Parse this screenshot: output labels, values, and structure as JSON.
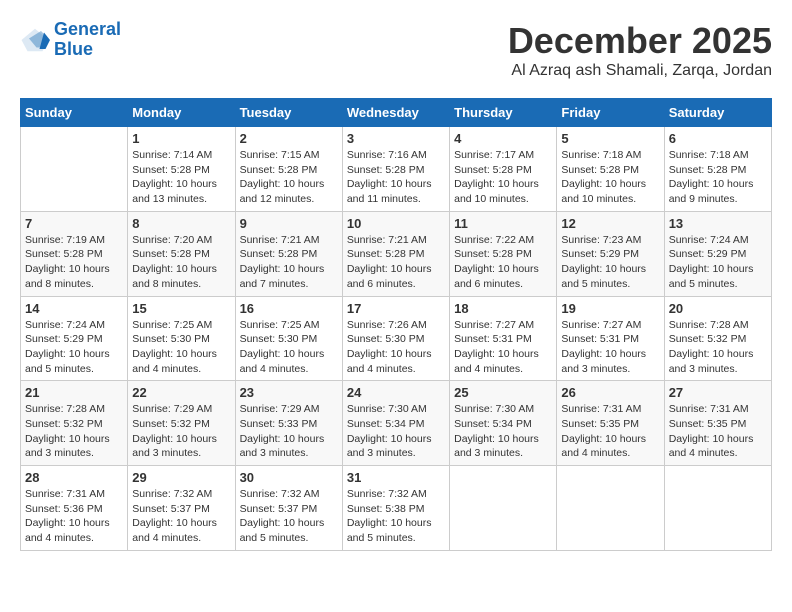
{
  "logo": {
    "line1": "General",
    "line2": "Blue"
  },
  "header": {
    "month_title": "December 2025",
    "location": "Al Azraq ash Shamali, Zarqa, Jordan"
  },
  "weekdays": [
    "Sunday",
    "Monday",
    "Tuesday",
    "Wednesday",
    "Thursday",
    "Friday",
    "Saturday"
  ],
  "weeks": [
    [
      {
        "day": "",
        "info": ""
      },
      {
        "day": "1",
        "info": "Sunrise: 7:14 AM\nSunset: 5:28 PM\nDaylight: 10 hours\nand 13 minutes."
      },
      {
        "day": "2",
        "info": "Sunrise: 7:15 AM\nSunset: 5:28 PM\nDaylight: 10 hours\nand 12 minutes."
      },
      {
        "day": "3",
        "info": "Sunrise: 7:16 AM\nSunset: 5:28 PM\nDaylight: 10 hours\nand 11 minutes."
      },
      {
        "day": "4",
        "info": "Sunrise: 7:17 AM\nSunset: 5:28 PM\nDaylight: 10 hours\nand 10 minutes."
      },
      {
        "day": "5",
        "info": "Sunrise: 7:18 AM\nSunset: 5:28 PM\nDaylight: 10 hours\nand 10 minutes."
      },
      {
        "day": "6",
        "info": "Sunrise: 7:18 AM\nSunset: 5:28 PM\nDaylight: 10 hours\nand 9 minutes."
      }
    ],
    [
      {
        "day": "7",
        "info": "Sunrise: 7:19 AM\nSunset: 5:28 PM\nDaylight: 10 hours\nand 8 minutes."
      },
      {
        "day": "8",
        "info": "Sunrise: 7:20 AM\nSunset: 5:28 PM\nDaylight: 10 hours\nand 8 minutes."
      },
      {
        "day": "9",
        "info": "Sunrise: 7:21 AM\nSunset: 5:28 PM\nDaylight: 10 hours\nand 7 minutes."
      },
      {
        "day": "10",
        "info": "Sunrise: 7:21 AM\nSunset: 5:28 PM\nDaylight: 10 hours\nand 6 minutes."
      },
      {
        "day": "11",
        "info": "Sunrise: 7:22 AM\nSunset: 5:28 PM\nDaylight: 10 hours\nand 6 minutes."
      },
      {
        "day": "12",
        "info": "Sunrise: 7:23 AM\nSunset: 5:29 PM\nDaylight: 10 hours\nand 5 minutes."
      },
      {
        "day": "13",
        "info": "Sunrise: 7:24 AM\nSunset: 5:29 PM\nDaylight: 10 hours\nand 5 minutes."
      }
    ],
    [
      {
        "day": "14",
        "info": "Sunrise: 7:24 AM\nSunset: 5:29 PM\nDaylight: 10 hours\nand 5 minutes."
      },
      {
        "day": "15",
        "info": "Sunrise: 7:25 AM\nSunset: 5:30 PM\nDaylight: 10 hours\nand 4 minutes."
      },
      {
        "day": "16",
        "info": "Sunrise: 7:25 AM\nSunset: 5:30 PM\nDaylight: 10 hours\nand 4 minutes."
      },
      {
        "day": "17",
        "info": "Sunrise: 7:26 AM\nSunset: 5:30 PM\nDaylight: 10 hours\nand 4 minutes."
      },
      {
        "day": "18",
        "info": "Sunrise: 7:27 AM\nSunset: 5:31 PM\nDaylight: 10 hours\nand 4 minutes."
      },
      {
        "day": "19",
        "info": "Sunrise: 7:27 AM\nSunset: 5:31 PM\nDaylight: 10 hours\nand 3 minutes."
      },
      {
        "day": "20",
        "info": "Sunrise: 7:28 AM\nSunset: 5:32 PM\nDaylight: 10 hours\nand 3 minutes."
      }
    ],
    [
      {
        "day": "21",
        "info": "Sunrise: 7:28 AM\nSunset: 5:32 PM\nDaylight: 10 hours\nand 3 minutes."
      },
      {
        "day": "22",
        "info": "Sunrise: 7:29 AM\nSunset: 5:32 PM\nDaylight: 10 hours\nand 3 minutes."
      },
      {
        "day": "23",
        "info": "Sunrise: 7:29 AM\nSunset: 5:33 PM\nDaylight: 10 hours\nand 3 minutes."
      },
      {
        "day": "24",
        "info": "Sunrise: 7:30 AM\nSunset: 5:34 PM\nDaylight: 10 hours\nand 3 minutes."
      },
      {
        "day": "25",
        "info": "Sunrise: 7:30 AM\nSunset: 5:34 PM\nDaylight: 10 hours\nand 3 minutes."
      },
      {
        "day": "26",
        "info": "Sunrise: 7:31 AM\nSunset: 5:35 PM\nDaylight: 10 hours\nand 4 minutes."
      },
      {
        "day": "27",
        "info": "Sunrise: 7:31 AM\nSunset: 5:35 PM\nDaylight: 10 hours\nand 4 minutes."
      }
    ],
    [
      {
        "day": "28",
        "info": "Sunrise: 7:31 AM\nSunset: 5:36 PM\nDaylight: 10 hours\nand 4 minutes."
      },
      {
        "day": "29",
        "info": "Sunrise: 7:32 AM\nSunset: 5:37 PM\nDaylight: 10 hours\nand 4 minutes."
      },
      {
        "day": "30",
        "info": "Sunrise: 7:32 AM\nSunset: 5:37 PM\nDaylight: 10 hours\nand 5 minutes."
      },
      {
        "day": "31",
        "info": "Sunrise: 7:32 AM\nSunset: 5:38 PM\nDaylight: 10 hours\nand 5 minutes."
      },
      {
        "day": "",
        "info": ""
      },
      {
        "day": "",
        "info": ""
      },
      {
        "day": "",
        "info": ""
      }
    ]
  ]
}
